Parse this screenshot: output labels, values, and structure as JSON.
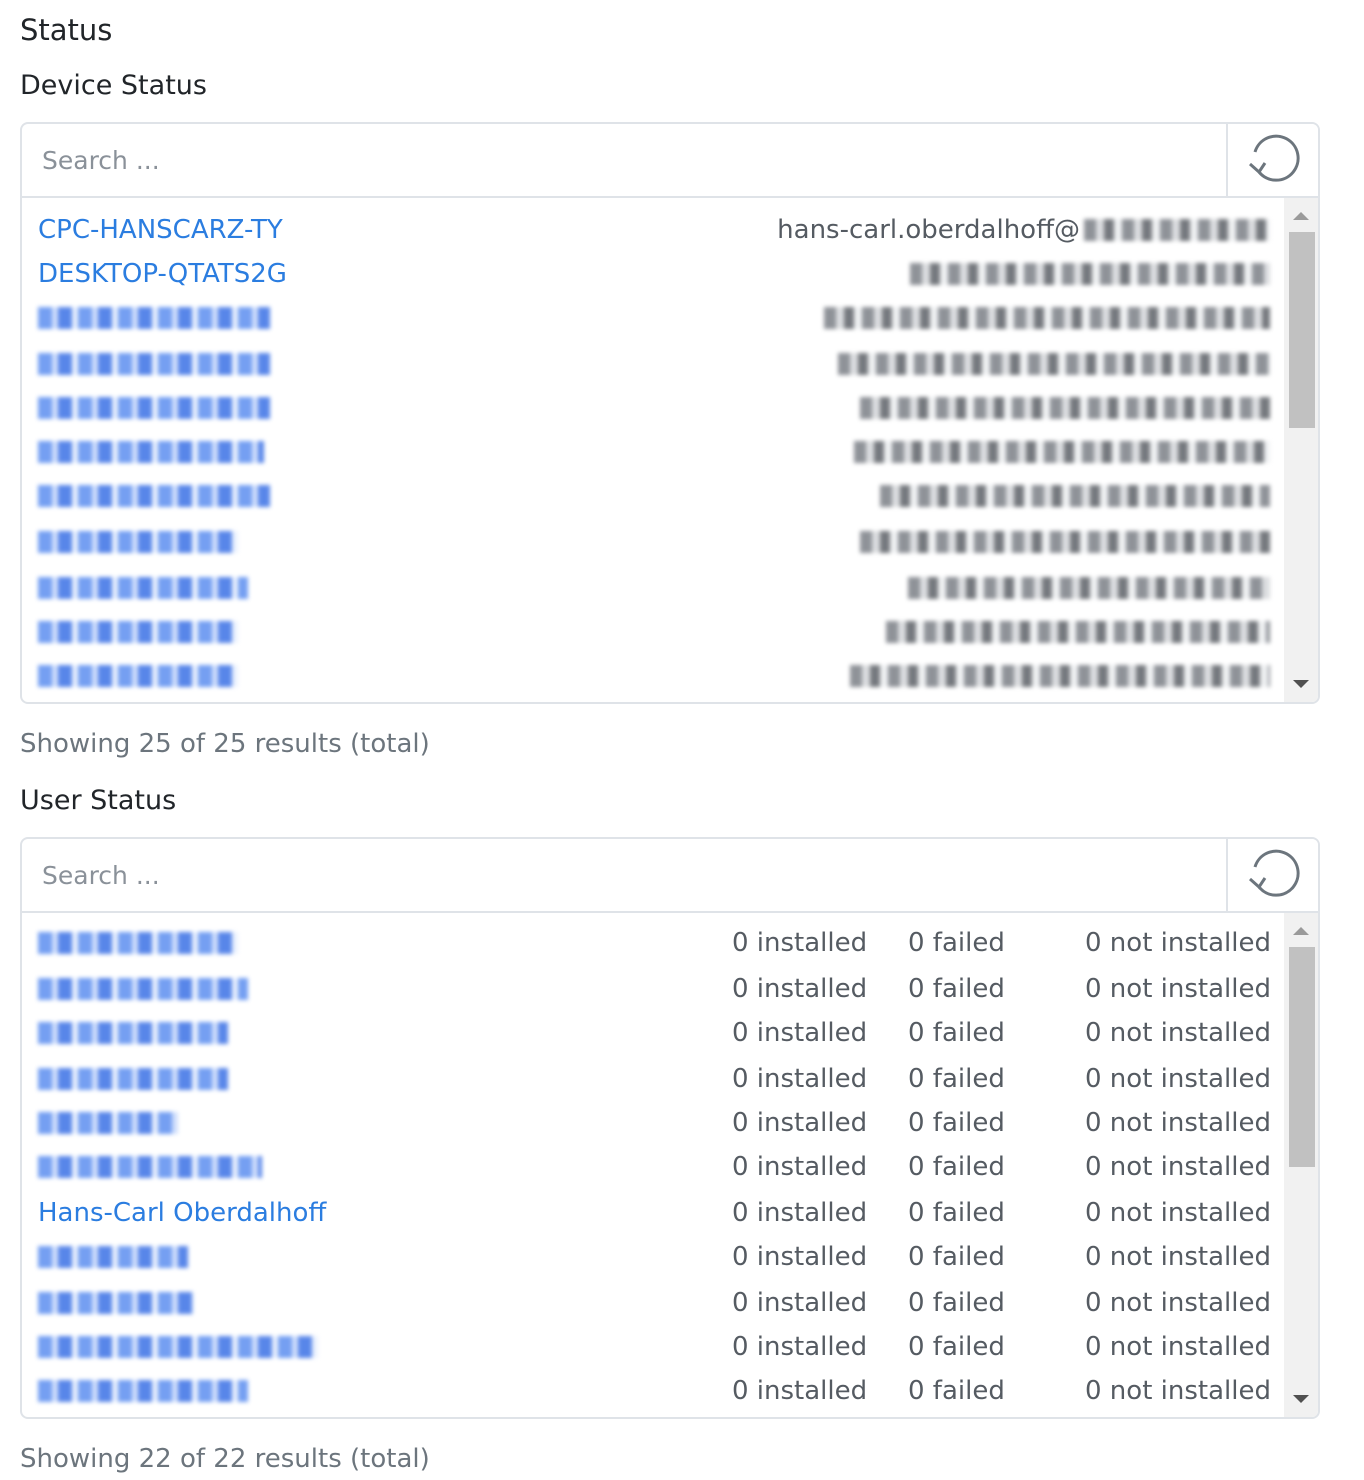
{
  "page": {
    "title": "Status"
  },
  "device_status": {
    "heading": "Device Status",
    "search": {
      "placeholder": "Search ...",
      "value": ""
    },
    "refresh_icon": "refresh-icon",
    "rows": [
      {
        "name": "CPC-HANSCARZ-TY",
        "user": "hans-carl.oberdalhoff@"
      },
      {
        "name": "DESKTOP-QTATS2G",
        "user": ""
      },
      {
        "name": "",
        "user": ""
      },
      {
        "name": "",
        "user": ""
      },
      {
        "name": "",
        "user": ""
      },
      {
        "name": "",
        "user": ""
      },
      {
        "name": "",
        "user": ""
      },
      {
        "name": "",
        "user": ""
      },
      {
        "name": "",
        "user": ""
      },
      {
        "name": "",
        "user": ""
      },
      {
        "name": "",
        "user": ""
      }
    ],
    "footer": "Showing 25 of 25 results (total)"
  },
  "user_status": {
    "heading": "User Status",
    "search": {
      "placeholder": "Search ...",
      "value": ""
    },
    "refresh_icon": "refresh-icon",
    "rows": [
      {
        "name": "",
        "installed": "0 installed",
        "failed": "0 failed",
        "not_installed": "0 not installed"
      },
      {
        "name": "",
        "installed": "0 installed",
        "failed": "0 failed",
        "not_installed": "0 not installed"
      },
      {
        "name": "",
        "installed": "0 installed",
        "failed": "0 failed",
        "not_installed": "0 not installed"
      },
      {
        "name": "",
        "installed": "0 installed",
        "failed": "0 failed",
        "not_installed": "0 not installed"
      },
      {
        "name": "",
        "installed": "0 installed",
        "failed": "0 failed",
        "not_installed": "0 not installed"
      },
      {
        "name": "",
        "installed": "0 installed",
        "failed": "0 failed",
        "not_installed": "0 not installed"
      },
      {
        "name": "Hans-Carl Oberdalhoff",
        "installed": "0 installed",
        "failed": "0 failed",
        "not_installed": "0 not installed"
      },
      {
        "name": "",
        "installed": "0 installed",
        "failed": "0 failed",
        "not_installed": "0 not installed"
      },
      {
        "name": "",
        "installed": "0 installed",
        "failed": "0 failed",
        "not_installed": "0 not installed"
      },
      {
        "name": "",
        "installed": "0 installed",
        "failed": "0 failed",
        "not_installed": "0 not installed"
      },
      {
        "name": "",
        "installed": "0 installed",
        "failed": "0 failed",
        "not_installed": "0 not installed"
      }
    ],
    "footer": "Showing 22 of 22 results (total)"
  },
  "colors": {
    "link": "#2b7de0",
    "muted": "#6c757d",
    "border": "#dfe3e8"
  }
}
